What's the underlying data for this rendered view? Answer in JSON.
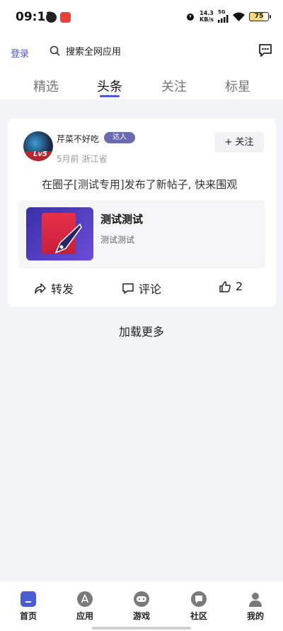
{
  "status_bar": {
    "time": "09:11",
    "net_speed_value": "14.3",
    "net_speed_unit": "KB/s",
    "network": "5G",
    "battery": "75"
  },
  "header": {
    "login_label": "登录",
    "search_placeholder": "搜索全网应用",
    "tabs": [
      "精选",
      "头条",
      "关注",
      "标星"
    ],
    "active_tab": "头条"
  },
  "post": {
    "username": "芹菜不好吃",
    "user_badge": "达人",
    "level": "Lv5",
    "meta": "5月前 浙江省",
    "follow_label": "+ 关注",
    "text": "在圈子[测试专用]发布了新帖子, 快来围观",
    "shared": {
      "title": "测试测试",
      "subtitle": "测试测试"
    },
    "actions": {
      "forward_label": "转发",
      "comment_label": "评论",
      "like_count": "2"
    }
  },
  "load_more_label": "加载更多",
  "bottom_nav": [
    {
      "label": "首页",
      "icon": "home-icon"
    },
    {
      "label": "应用",
      "icon": "app-store-icon"
    },
    {
      "label": "游戏",
      "icon": "gamepad-icon"
    },
    {
      "label": "社区",
      "icon": "chat-bubble-icon"
    },
    {
      "label": "我的",
      "icon": "profile-icon"
    }
  ],
  "colors": {
    "accent": "#4a5bd6",
    "background": "#f3f4f8",
    "badge": "#6a6ab0"
  }
}
